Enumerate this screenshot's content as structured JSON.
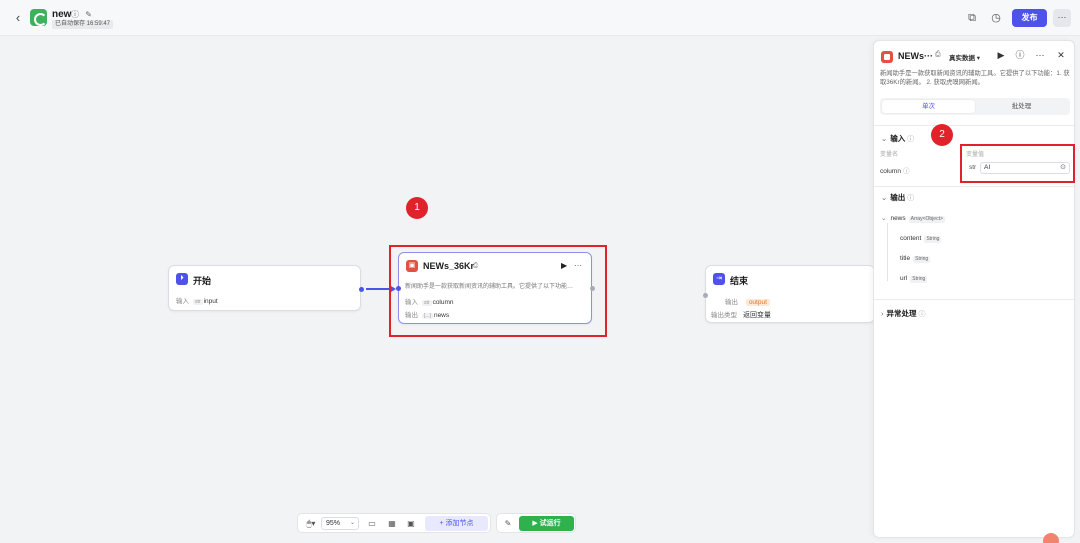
{
  "header": {
    "app_name": "new",
    "title_icons": "ⓘ ✎",
    "autosave": "已自动保存 16:59:47",
    "publish_label": "发布",
    "more_label": "···"
  },
  "canvas": {
    "start_node": {
      "title": "开始",
      "input_label": "输入",
      "input_tag": "str",
      "input_value": "input"
    },
    "plugin_node": {
      "title": "NEWs_36Kr",
      "desc": "新闻助手是一款获取新闻资讯的辅助工具。它提供了以下功能…",
      "input_label": "输入",
      "input_tag": "str",
      "input_value": "column",
      "output_label": "输出",
      "output_tag": "[...]",
      "output_value": "news",
      "more": "···"
    },
    "end_node": {
      "title": "结束",
      "output_label": "输出",
      "output_value": "output",
      "output_type_label": "输出类型",
      "output_type_value": "返回变量"
    },
    "annotations": {
      "marker_1": "1",
      "marker_2": "2"
    }
  },
  "toolbar": {
    "zoom": "95%",
    "add_node_label": "+ 添加节点",
    "run_label": "▶ 试运行"
  },
  "panel": {
    "title": "NEWs···",
    "mode": "真实数据 ▾",
    "description": "新闻助手是一款获取新闻资讯的辅助工具。它提供了以下功能：1. 获取36Kr的新闻。 2. 获取虎嗅网新闻。",
    "tabs": [
      "单次",
      "批处理"
    ],
    "input_section": "输入",
    "var_name_header": "变量名",
    "var_value_header": "变量值",
    "field_name": "column",
    "field_type": "str",
    "field_value": "AI",
    "output_section": "输出",
    "outputs": [
      {
        "name": "news",
        "type": "Array<Object>"
      },
      {
        "name": "content",
        "type": "String"
      },
      {
        "name": "title",
        "type": "String"
      },
      {
        "name": "url",
        "type": "String"
      }
    ],
    "exception_section": "异常处理"
  }
}
